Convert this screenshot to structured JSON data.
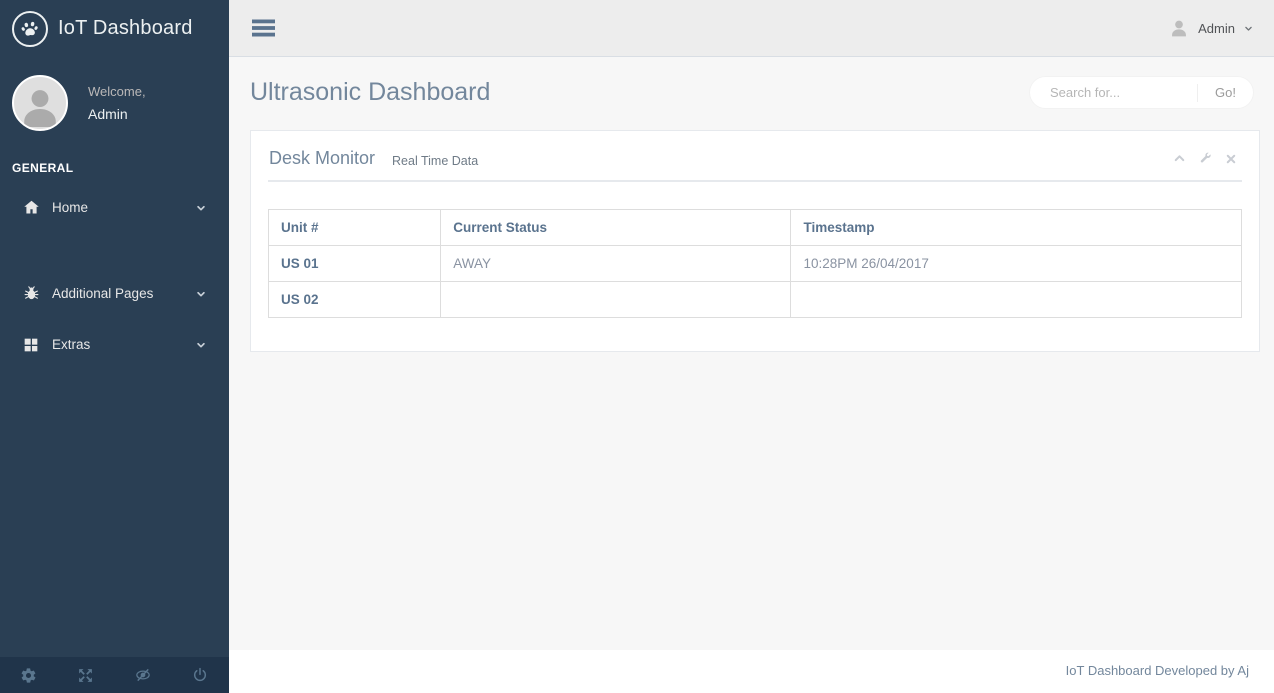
{
  "brand": {
    "title": "IoT Dashboard"
  },
  "sidebar": {
    "welcome_label": "Welcome,",
    "username": "Admin",
    "section_label": "GENERAL",
    "menu": [
      {
        "label": "Home",
        "icon": "home-icon"
      },
      {
        "label": "Additional Pages",
        "icon": "bug-icon"
      },
      {
        "label": "Extras",
        "icon": "windows-icon"
      }
    ],
    "footer_icons": [
      "gear-icon",
      "fullscreen-icon",
      "eye-slash-icon",
      "power-icon"
    ]
  },
  "topbar": {
    "username": "Admin"
  },
  "page": {
    "title": "Ultrasonic Dashboard"
  },
  "search": {
    "placeholder": "Search for...",
    "button_label": "Go!"
  },
  "panel": {
    "title": "Desk Monitor",
    "subtitle": "Real Time Data",
    "tool_icons": [
      "chevron-up-icon",
      "wrench-icon",
      "close-icon"
    ]
  },
  "table": {
    "headers": [
      "Unit #",
      "Current Status",
      "Timestamp"
    ],
    "rows": [
      {
        "unit": "US 01",
        "status": "AWAY",
        "timestamp": "10:28PM 26/04/2017"
      },
      {
        "unit": "US 02",
        "status": "",
        "timestamp": ""
      }
    ]
  },
  "footer": {
    "text": "IoT Dashboard Developed by Aj"
  },
  "colors": {
    "sidebar_bg": "#2A3F54",
    "sidebar_footer_bg": "#20344A",
    "topbar_bg": "#EDEDED",
    "content_bg": "#F7F7F7",
    "accent_text": "#73879C",
    "table_header_text": "#5A738E",
    "panel_border": "#E6E9ED",
    "table_border": "#DDDDDD"
  }
}
